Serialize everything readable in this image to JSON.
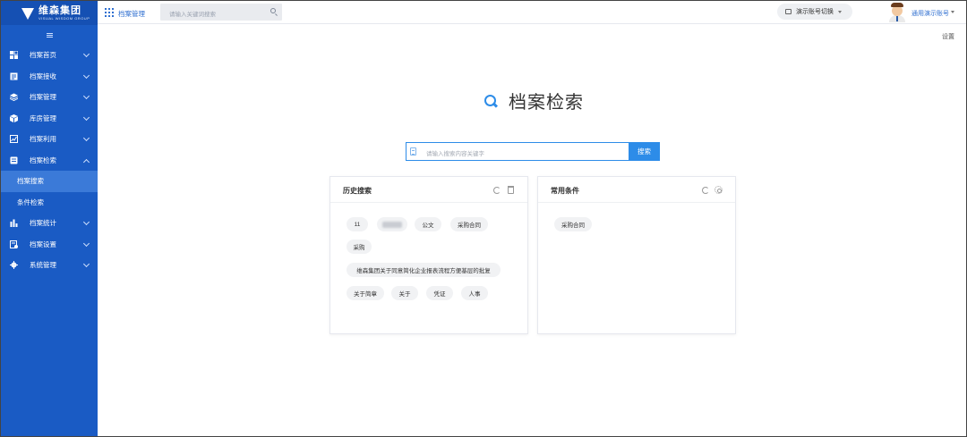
{
  "brand": {
    "name_cn": "维森集团",
    "name_en": "VISUAL WISDOM GROUP"
  },
  "header": {
    "title": "档案管理",
    "search_placeholder": "请输入关键词搜索",
    "account_switch": "演示账号切换",
    "user_name": "通用演示账号"
  },
  "settings_label": "设置",
  "sidebar": {
    "items": [
      {
        "label": "档案首页",
        "icon": "dashboard-icon"
      },
      {
        "label": "档案接收",
        "icon": "receive-icon"
      },
      {
        "label": "档案管理",
        "icon": "layers-icon"
      },
      {
        "label": "库房管理",
        "icon": "box-icon"
      },
      {
        "label": "档案利用",
        "icon": "chart-icon"
      },
      {
        "label": "档案检索",
        "icon": "search-list-icon",
        "expanded": true,
        "children": [
          {
            "label": "档案搜索",
            "active": true
          },
          {
            "label": "条件检索"
          }
        ]
      },
      {
        "label": "档案统计",
        "icon": "bar-chart-icon"
      },
      {
        "label": "档案设置",
        "icon": "settings-doc-icon"
      },
      {
        "label": "系统管理",
        "icon": "gear-icon"
      }
    ]
  },
  "main": {
    "heading": "档案检索",
    "search_placeholder": "请输入搜索内容关键字",
    "search_button": "搜索"
  },
  "history": {
    "title": "历史搜索",
    "tags": [
      "11",
      "",
      "公文",
      "采购合同",
      "采购",
      "维森集团关于同意简化企业报表流程方便基层的批复",
      "关于简章",
      "关于",
      "凭证",
      "人事"
    ]
  },
  "common": {
    "title": "常用条件",
    "tags": [
      "采购合同"
    ]
  },
  "colors": {
    "sidebar": "#1a5bc4",
    "accent": "#2d8ce8",
    "active_item": "#3b7ad8"
  }
}
